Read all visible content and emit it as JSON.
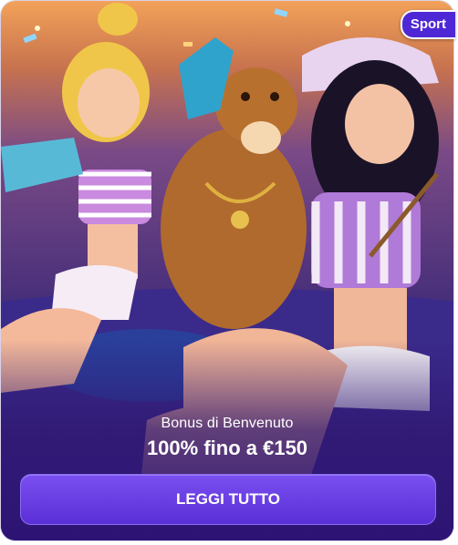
{
  "badge": {
    "label": "Sport"
  },
  "promo": {
    "subtitle": "Bonus di Benvenuto",
    "headline": "100% fino a €150"
  },
  "cta": {
    "label": "LEGGI TUTTO"
  },
  "colors": {
    "badge": "#4f28d6",
    "button": "#6a3fe6",
    "background_bottom": "#2d1474"
  }
}
